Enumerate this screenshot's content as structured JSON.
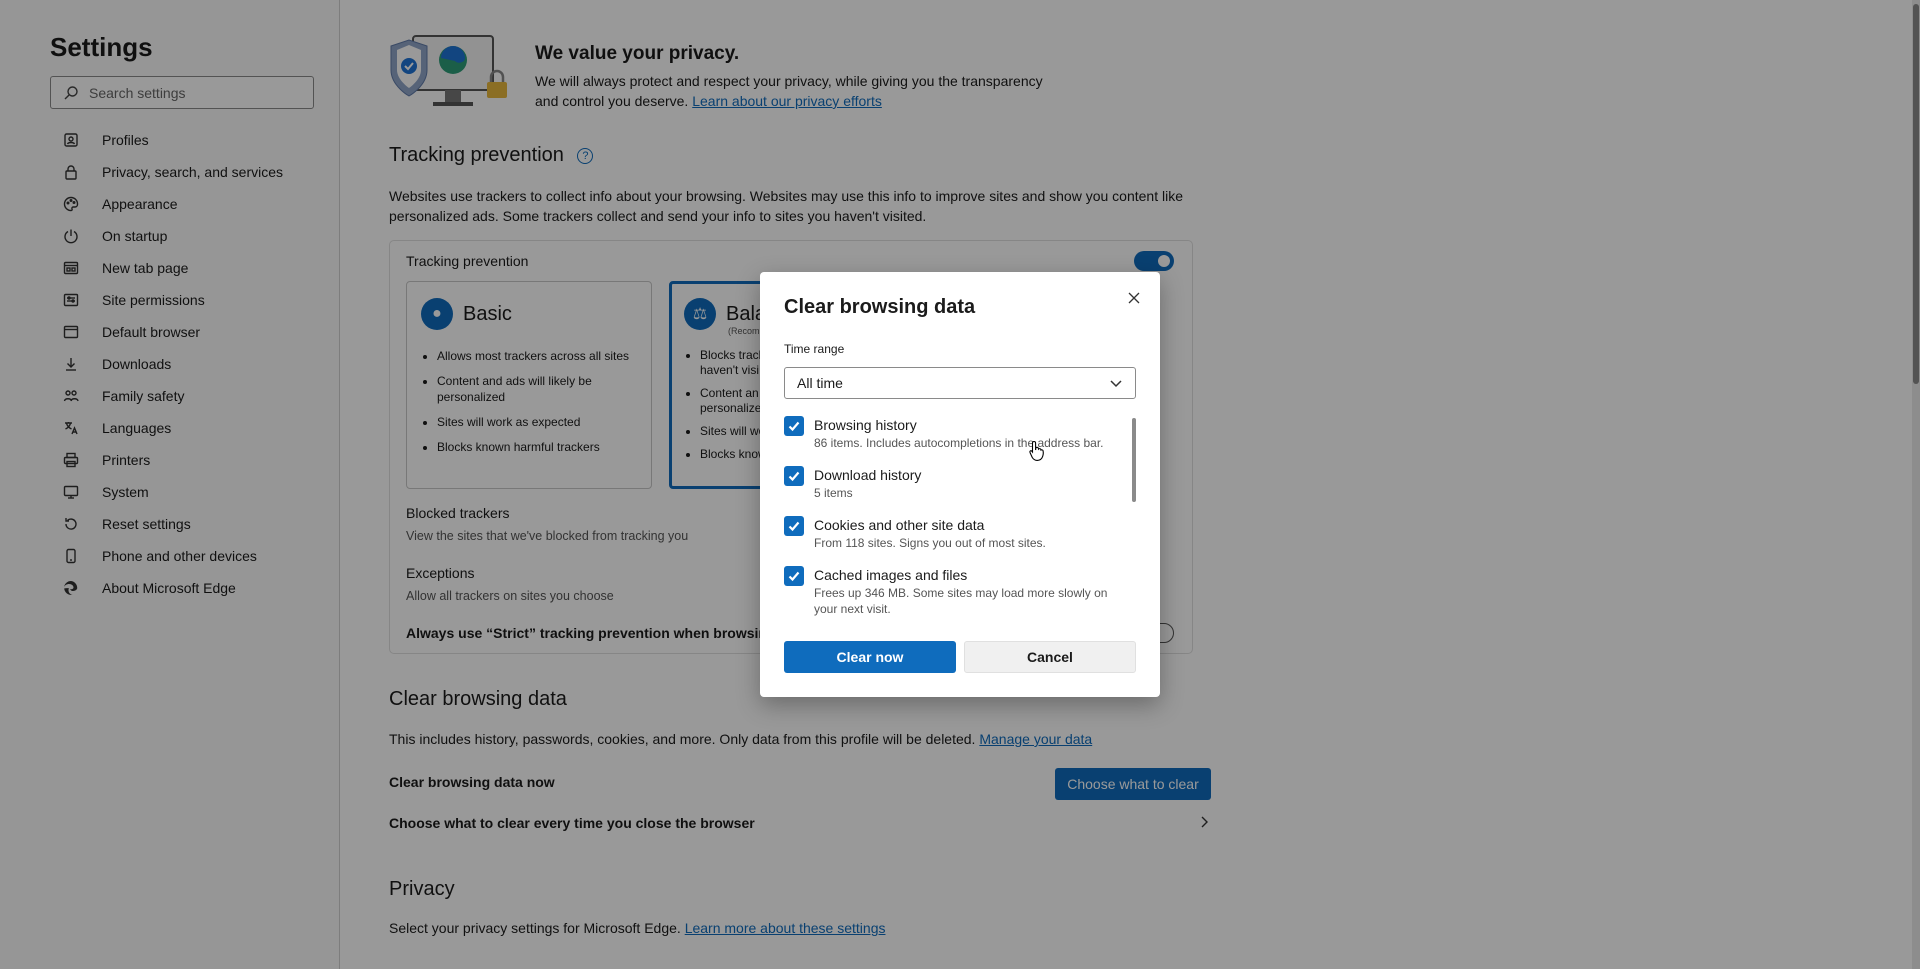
{
  "sidebar": {
    "title": "Settings",
    "search_placeholder": "Search settings",
    "items": [
      {
        "label": "Profiles",
        "icon": "profile-icon"
      },
      {
        "label": "Privacy, search, and services",
        "icon": "lock-icon"
      },
      {
        "label": "Appearance",
        "icon": "palette-icon"
      },
      {
        "label": "On startup",
        "icon": "power-icon"
      },
      {
        "label": "New tab page",
        "icon": "newtab-icon"
      },
      {
        "label": "Site permissions",
        "icon": "site-permissions-icon"
      },
      {
        "label": "Default browser",
        "icon": "browser-icon"
      },
      {
        "label": "Downloads",
        "icon": "download-icon"
      },
      {
        "label": "Family safety",
        "icon": "family-icon"
      },
      {
        "label": "Languages",
        "icon": "languages-icon"
      },
      {
        "label": "Printers",
        "icon": "printer-icon"
      },
      {
        "label": "System",
        "icon": "system-icon"
      },
      {
        "label": "Reset settings",
        "icon": "reset-icon"
      },
      {
        "label": "Phone and other devices",
        "icon": "phone-icon"
      },
      {
        "label": "About Microsoft Edge",
        "icon": "edge-icon"
      }
    ]
  },
  "privacy_banner": {
    "title": "We value your privacy.",
    "desc": "We will always protect and respect your privacy, while giving you the transparency and control you deserve.",
    "link": "Learn about our privacy efforts"
  },
  "tracking": {
    "title": "Tracking prevention",
    "desc": "Websites use trackers to collect info about your browsing. Websites may use this info to improve sites and show you content like personalized ads. Some trackers collect and send your info to sites you haven't visited.",
    "toggle_label": "Tracking prevention",
    "basic": {
      "name": "Basic",
      "bullets": [
        "Allows most trackers across all sites",
        "Content and ads will likely be personalized",
        "Sites will work as expected",
        "Blocks known harmful trackers"
      ]
    },
    "balanced": {
      "name": "Bala",
      "sub": "(Recom",
      "bullets": [
        "Blocks track",
        "haven't visi",
        "Content an",
        "personalize",
        "Sites will wo",
        "Blocks know"
      ]
    },
    "blocked_title": "Blocked trackers",
    "blocked_sub": "View the sites that we've blocked from tracking you",
    "exceptions_title": "Exceptions",
    "exceptions_sub": "Allow all trackers on sites you choose",
    "strict_label": "Always use “Strict” tracking prevention when browsing I"
  },
  "clear_section": {
    "title": "Clear browsing data",
    "desc": "This includes history, passwords, cookies, and more. Only data from this profile will be deleted.",
    "desc_link": "Manage your data",
    "now_label": "Clear browsing data now",
    "choose_button": "Choose what to clear",
    "every_time": "Choose what to clear every time you close the browser"
  },
  "privacy_section": {
    "title": "Privacy",
    "desc": "Select your privacy settings for Microsoft Edge.",
    "link": "Learn more about these settings"
  },
  "dialog": {
    "title": "Clear browsing data",
    "time_range_label": "Time range",
    "time_range_value": "All time",
    "options": [
      {
        "title": "Browsing history",
        "sub": "86 items. Includes autocompletions in the address bar.",
        "checked": true
      },
      {
        "title": "Download history",
        "sub": "5 items",
        "checked": true
      },
      {
        "title": "Cookies and other site data",
        "sub": "From 118 sites. Signs you out of most sites.",
        "checked": true
      },
      {
        "title": "Cached images and files",
        "sub": "Frees up 346 MB. Some sites may load more slowly on your next visit.",
        "checked": true
      }
    ],
    "clear_button": "Clear now",
    "cancel_button": "Cancel"
  },
  "colors": {
    "accent": "#0f6cbd",
    "overlay": "rgba(0,0,0,0.4)"
  }
}
